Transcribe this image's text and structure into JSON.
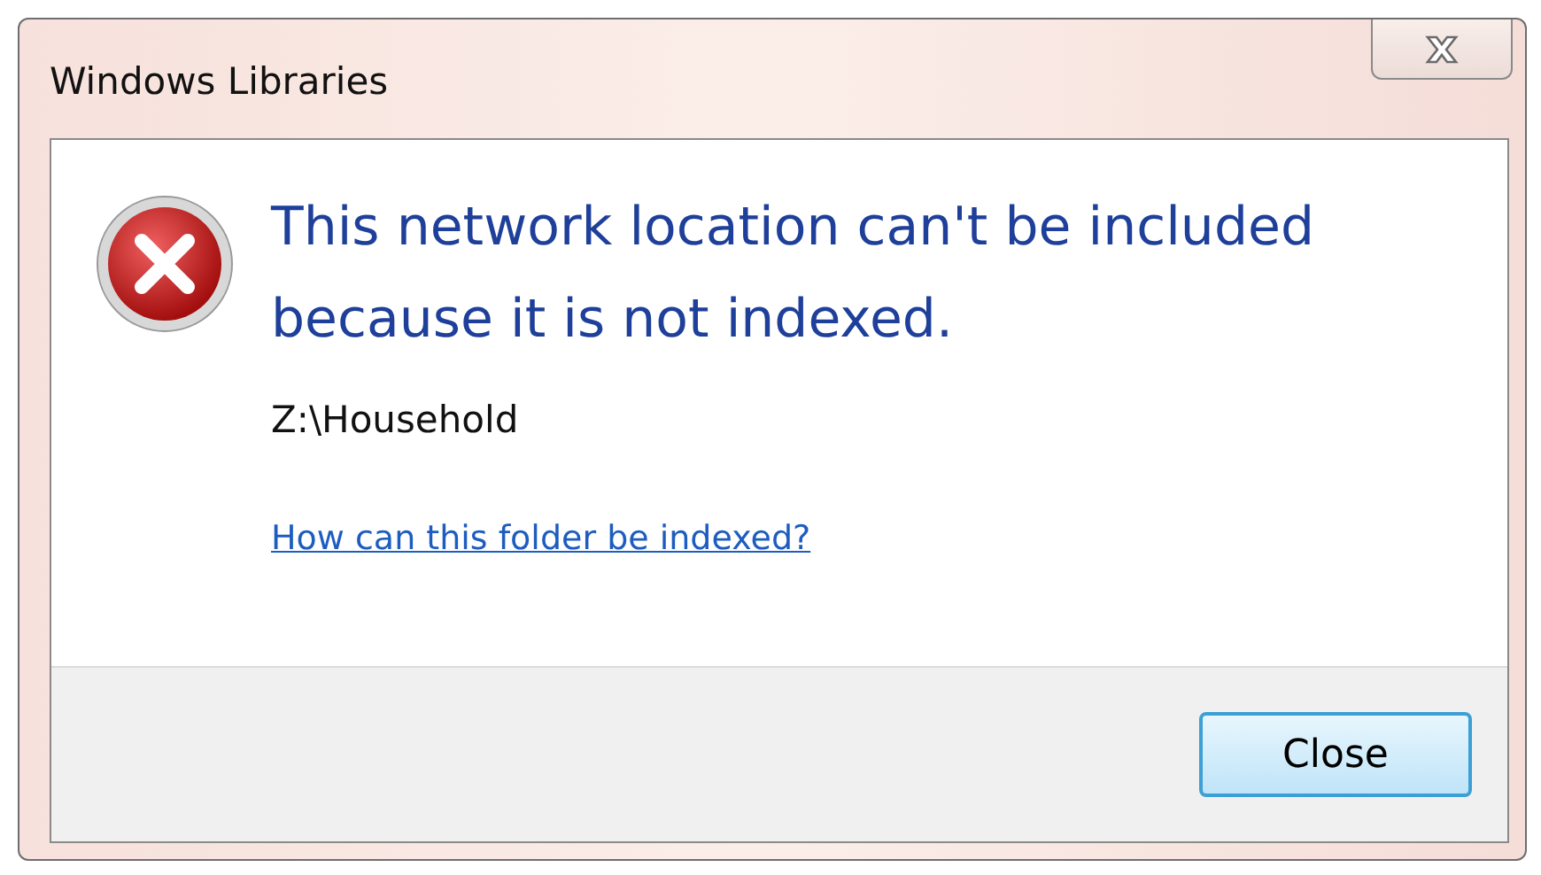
{
  "window": {
    "title": "Windows Libraries"
  },
  "message": {
    "heading": "This network location can't be included because it is not indexed.",
    "path": "Z:\\Household",
    "link": "How can this folder be indexed?"
  },
  "buttons": [
    {
      "label": "Close",
      "default": true
    }
  ]
}
